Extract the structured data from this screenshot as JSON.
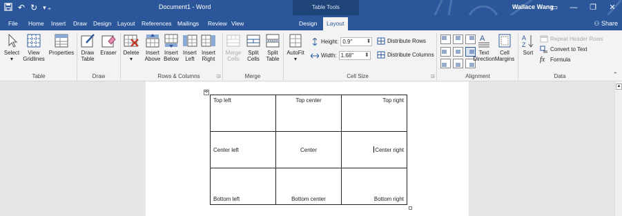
{
  "titlebar": {
    "doc_title": "Document1 - Word",
    "context_title": "Table Tools",
    "user": "Wallace Wang",
    "qat": [
      "save-icon",
      "undo-icon",
      "redo-icon",
      "customize-icon"
    ]
  },
  "tabs": [
    {
      "label": "File"
    },
    {
      "label": "Home"
    },
    {
      "label": "Insert"
    },
    {
      "label": "Draw"
    },
    {
      "label": "Design"
    },
    {
      "label": "Layout"
    },
    {
      "label": "References"
    },
    {
      "label": "Mailings"
    },
    {
      "label": "Review"
    },
    {
      "label": "View"
    },
    {
      "label": "Design"
    },
    {
      "label": "Layout"
    }
  ],
  "share_label": "Share",
  "ribbon": {
    "table": {
      "select": "Select",
      "view_gridlines_1": "View",
      "view_gridlines_2": "Gridlines",
      "properties": "Properties",
      "label": "Table"
    },
    "draw": {
      "draw_table_1": "Draw",
      "draw_table_2": "Table",
      "eraser": "Eraser",
      "label": "Draw"
    },
    "rows_columns": {
      "delete": "Delete",
      "insert_above_1": "Insert",
      "insert_above_2": "Above",
      "insert_below_1": "Insert",
      "insert_below_2": "Below",
      "insert_left_1": "Insert",
      "insert_left_2": "Left",
      "insert_right_1": "Insert",
      "insert_right_2": "Right",
      "label": "Rows & Columns"
    },
    "merge": {
      "merge_cells_1": "Merge",
      "merge_cells_2": "Cells",
      "split_cells_1": "Split",
      "split_cells_2": "Cells",
      "split_table_1": "Split",
      "split_table_2": "Table",
      "label": "Merge"
    },
    "cell_size": {
      "autofit": "AutoFit",
      "height_label": "Height:",
      "height_value": "0.9\"",
      "width_label": "Width:",
      "width_value": "1.68\"",
      "distribute_rows": "Distribute Rows",
      "distribute_columns": "Distribute Columns",
      "label": "Cell Size"
    },
    "alignment": {
      "text_direction_1": "Text",
      "text_direction_2": "Direction",
      "cell_margins_1": "Cell",
      "cell_margins_2": "Margins",
      "label": "Alignment"
    },
    "data": {
      "sort": "Sort",
      "repeat_header_rows": "Repeat Header Rows",
      "convert_to_text": "Convert to Text",
      "formula": "Formula",
      "label": "Data"
    }
  },
  "table": {
    "rows": [
      [
        "Top left",
        "Top center",
        "Top right"
      ],
      [
        "Center left",
        "Center",
        "Center right"
      ],
      [
        "Bottom left",
        "Bottom center",
        "Bottom right"
      ]
    ]
  },
  "colors": {
    "accent": "#2b579a",
    "context": "#1f4478",
    "ribbon_bg": "#f3f3f3"
  }
}
